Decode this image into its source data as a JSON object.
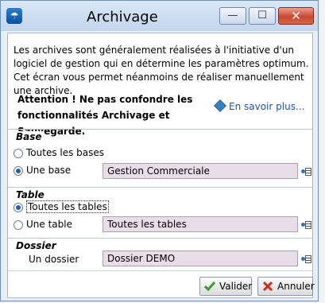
{
  "window": {
    "title": "Archivage",
    "minimize": "—",
    "maximize": "☐",
    "close": "✕"
  },
  "intro": "Les archives sont généralement réalisées à l'initiative d'un logiciel de gestion qui en détermine  les paramètres optimum.  Cet écran vous permet néanmoins de réaliser manuellement une archive.",
  "warning": {
    "line1": "Attention ! Ne pas confondre les",
    "line2": "fonctionnalités Archivage et Sauvegarde."
  },
  "more_link": "En savoir plus...",
  "base": {
    "legend": "Base",
    "option_all": "Toutes les bases",
    "option_one": "Une base",
    "selected": "one",
    "value": "Gestion Commerciale"
  },
  "table": {
    "legend": "Table",
    "option_all": "Toutes les tables",
    "option_one": "Une table",
    "selected": "all",
    "value": "Toutes les tables"
  },
  "dossier": {
    "legend": "Dossier",
    "label": "Un dossier",
    "value": "Dossier DEMO"
  },
  "buttons": {
    "ok": "Valider",
    "cancel": "Annuler"
  }
}
